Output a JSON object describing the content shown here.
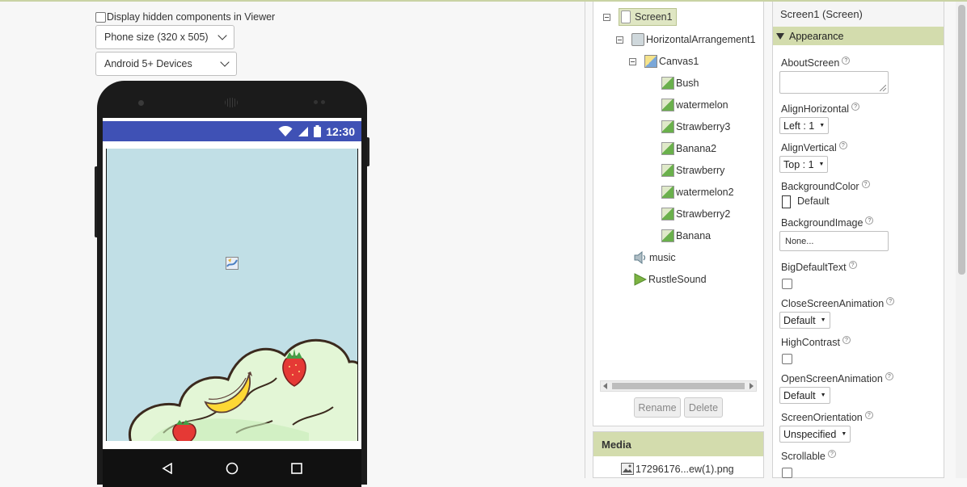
{
  "viewer": {
    "hidden_components_label": "Display hidden components in Viewer",
    "size_select": "Phone size (320 x 505)",
    "device_select": "Android 5+ Devices",
    "status_time": "12:30"
  },
  "components": {
    "tree": {
      "screen": "Screen1",
      "arrangement": "HorizontalArrangement1",
      "canvas": "Canvas1",
      "sprites": [
        "Bush",
        "watermelon",
        "Strawberry3",
        "Banana2",
        "Strawberry",
        "watermelon2",
        "Strawberry2",
        "Banana"
      ],
      "music": "music",
      "sound": "RustleSound"
    },
    "rename_label": "Rename",
    "delete_label": "Delete"
  },
  "media": {
    "header": "Media",
    "file": "17296176...ew(1).png"
  },
  "properties": {
    "title": "Screen1 (Screen)",
    "group": "Appearance",
    "about_screen": "AboutScreen",
    "align_horizontal": "AlignHorizontal",
    "align_horizontal_value": "Left : 1",
    "align_vertical": "AlignVertical",
    "align_vertical_value": "Top : 1",
    "background_color": "BackgroundColor",
    "background_color_value": "Default",
    "background_image": "BackgroundImage",
    "background_image_value": "None...",
    "big_default_text": "BigDefaultText",
    "close_screen_animation": "CloseScreenAnimation",
    "close_screen_animation_value": "Default",
    "high_contrast": "HighContrast",
    "open_screen_animation": "OpenScreenAnimation",
    "open_screen_animation_value": "Default",
    "screen_orientation": "ScreenOrientation",
    "screen_orientation_value": "Unspecified",
    "scrollable": "Scrollable",
    "help_glyph": "?"
  },
  "colors": {
    "accent_green": "#d3dcad",
    "status_bar": "#3f51b5",
    "canvas_bg": "#c1dfe6"
  }
}
